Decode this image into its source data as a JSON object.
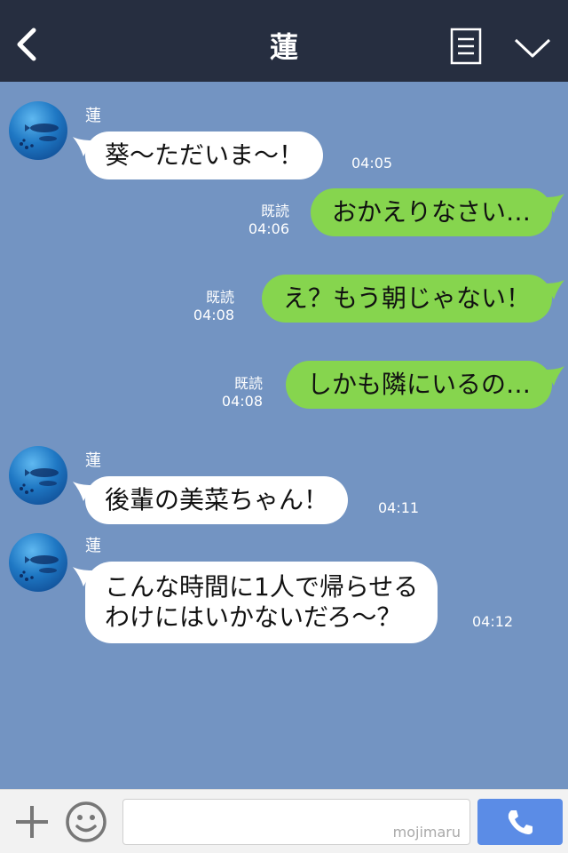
{
  "header": {
    "title": "蓮"
  },
  "messages": [
    {
      "direction": "incoming",
      "sender": "蓮",
      "lines": [
        "葵〜ただいま〜！"
      ],
      "time": "04:05"
    },
    {
      "direction": "outgoing",
      "read": "既読",
      "lines": [
        "おかえりなさい…"
      ],
      "time": "04:06"
    },
    {
      "direction": "outgoing",
      "read": "既読",
      "lines": [
        "え？もう朝じゃない！"
      ],
      "time": "04:08"
    },
    {
      "direction": "outgoing",
      "read": "既読",
      "lines": [
        "しかも隣にいるの…"
      ],
      "time": "04:08"
    },
    {
      "direction": "incoming",
      "sender": "蓮",
      "lines": [
        "後輩の美菜ちゃん！"
      ],
      "time": "04:11"
    },
    {
      "direction": "incoming",
      "sender": "蓮",
      "lines": [
        "こんな時間に1人で帰らせる",
        "わけにはいかないだろ〜？"
      ],
      "time": "04:12"
    }
  ],
  "input": {
    "placeholder": "",
    "watermark": "mojimaru"
  },
  "colors": {
    "header": "#262e40",
    "chat_bg": "#7394c2",
    "outgoing_bubble": "#86d54e",
    "incoming_bubble": "#ffffff",
    "call_button": "#5b8ce6"
  },
  "icons": {
    "back": "chevron-left-icon",
    "menu": "menu-list-icon",
    "collapse": "chevron-down-icon",
    "add": "plus-icon",
    "emoji": "smiley-icon",
    "call": "phone-icon"
  }
}
